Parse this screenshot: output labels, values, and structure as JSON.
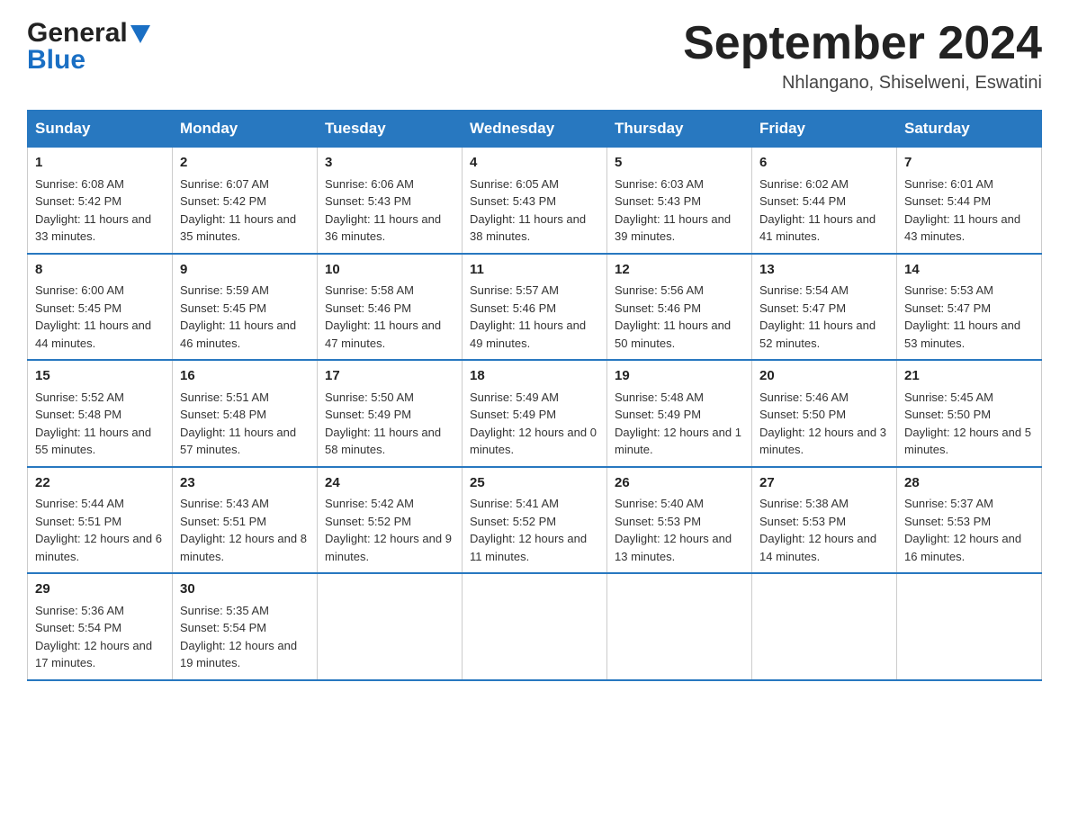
{
  "header": {
    "logo_general": "General",
    "logo_blue": "Blue",
    "month_year": "September 2024",
    "location": "Nhlangano, Shiselweni, Eswatini"
  },
  "days_of_week": [
    "Sunday",
    "Monday",
    "Tuesday",
    "Wednesday",
    "Thursday",
    "Friday",
    "Saturday"
  ],
  "weeks": [
    [
      {
        "day": "1",
        "sunrise": "6:08 AM",
        "sunset": "5:42 PM",
        "daylight": "11 hours and 33 minutes."
      },
      {
        "day": "2",
        "sunrise": "6:07 AM",
        "sunset": "5:42 PM",
        "daylight": "11 hours and 35 minutes."
      },
      {
        "day": "3",
        "sunrise": "6:06 AM",
        "sunset": "5:43 PM",
        "daylight": "11 hours and 36 minutes."
      },
      {
        "day": "4",
        "sunrise": "6:05 AM",
        "sunset": "5:43 PM",
        "daylight": "11 hours and 38 minutes."
      },
      {
        "day": "5",
        "sunrise": "6:03 AM",
        "sunset": "5:43 PM",
        "daylight": "11 hours and 39 minutes."
      },
      {
        "day": "6",
        "sunrise": "6:02 AM",
        "sunset": "5:44 PM",
        "daylight": "11 hours and 41 minutes."
      },
      {
        "day": "7",
        "sunrise": "6:01 AM",
        "sunset": "5:44 PM",
        "daylight": "11 hours and 43 minutes."
      }
    ],
    [
      {
        "day": "8",
        "sunrise": "6:00 AM",
        "sunset": "5:45 PM",
        "daylight": "11 hours and 44 minutes."
      },
      {
        "day": "9",
        "sunrise": "5:59 AM",
        "sunset": "5:45 PM",
        "daylight": "11 hours and 46 minutes."
      },
      {
        "day": "10",
        "sunrise": "5:58 AM",
        "sunset": "5:46 PM",
        "daylight": "11 hours and 47 minutes."
      },
      {
        "day": "11",
        "sunrise": "5:57 AM",
        "sunset": "5:46 PM",
        "daylight": "11 hours and 49 minutes."
      },
      {
        "day": "12",
        "sunrise": "5:56 AM",
        "sunset": "5:46 PM",
        "daylight": "11 hours and 50 minutes."
      },
      {
        "day": "13",
        "sunrise": "5:54 AM",
        "sunset": "5:47 PM",
        "daylight": "11 hours and 52 minutes."
      },
      {
        "day": "14",
        "sunrise": "5:53 AM",
        "sunset": "5:47 PM",
        "daylight": "11 hours and 53 minutes."
      }
    ],
    [
      {
        "day": "15",
        "sunrise": "5:52 AM",
        "sunset": "5:48 PM",
        "daylight": "11 hours and 55 minutes."
      },
      {
        "day": "16",
        "sunrise": "5:51 AM",
        "sunset": "5:48 PM",
        "daylight": "11 hours and 57 minutes."
      },
      {
        "day": "17",
        "sunrise": "5:50 AM",
        "sunset": "5:49 PM",
        "daylight": "11 hours and 58 minutes."
      },
      {
        "day": "18",
        "sunrise": "5:49 AM",
        "sunset": "5:49 PM",
        "daylight": "12 hours and 0 minutes."
      },
      {
        "day": "19",
        "sunrise": "5:48 AM",
        "sunset": "5:49 PM",
        "daylight": "12 hours and 1 minute."
      },
      {
        "day": "20",
        "sunrise": "5:46 AM",
        "sunset": "5:50 PM",
        "daylight": "12 hours and 3 minutes."
      },
      {
        "day": "21",
        "sunrise": "5:45 AM",
        "sunset": "5:50 PM",
        "daylight": "12 hours and 5 minutes."
      }
    ],
    [
      {
        "day": "22",
        "sunrise": "5:44 AM",
        "sunset": "5:51 PM",
        "daylight": "12 hours and 6 minutes."
      },
      {
        "day": "23",
        "sunrise": "5:43 AM",
        "sunset": "5:51 PM",
        "daylight": "12 hours and 8 minutes."
      },
      {
        "day": "24",
        "sunrise": "5:42 AM",
        "sunset": "5:52 PM",
        "daylight": "12 hours and 9 minutes."
      },
      {
        "day": "25",
        "sunrise": "5:41 AM",
        "sunset": "5:52 PM",
        "daylight": "12 hours and 11 minutes."
      },
      {
        "day": "26",
        "sunrise": "5:40 AM",
        "sunset": "5:53 PM",
        "daylight": "12 hours and 13 minutes."
      },
      {
        "day": "27",
        "sunrise": "5:38 AM",
        "sunset": "5:53 PM",
        "daylight": "12 hours and 14 minutes."
      },
      {
        "day": "28",
        "sunrise": "5:37 AM",
        "sunset": "5:53 PM",
        "daylight": "12 hours and 16 minutes."
      }
    ],
    [
      {
        "day": "29",
        "sunrise": "5:36 AM",
        "sunset": "5:54 PM",
        "daylight": "12 hours and 17 minutes."
      },
      {
        "day": "30",
        "sunrise": "5:35 AM",
        "sunset": "5:54 PM",
        "daylight": "12 hours and 19 minutes."
      },
      null,
      null,
      null,
      null,
      null
    ]
  ]
}
